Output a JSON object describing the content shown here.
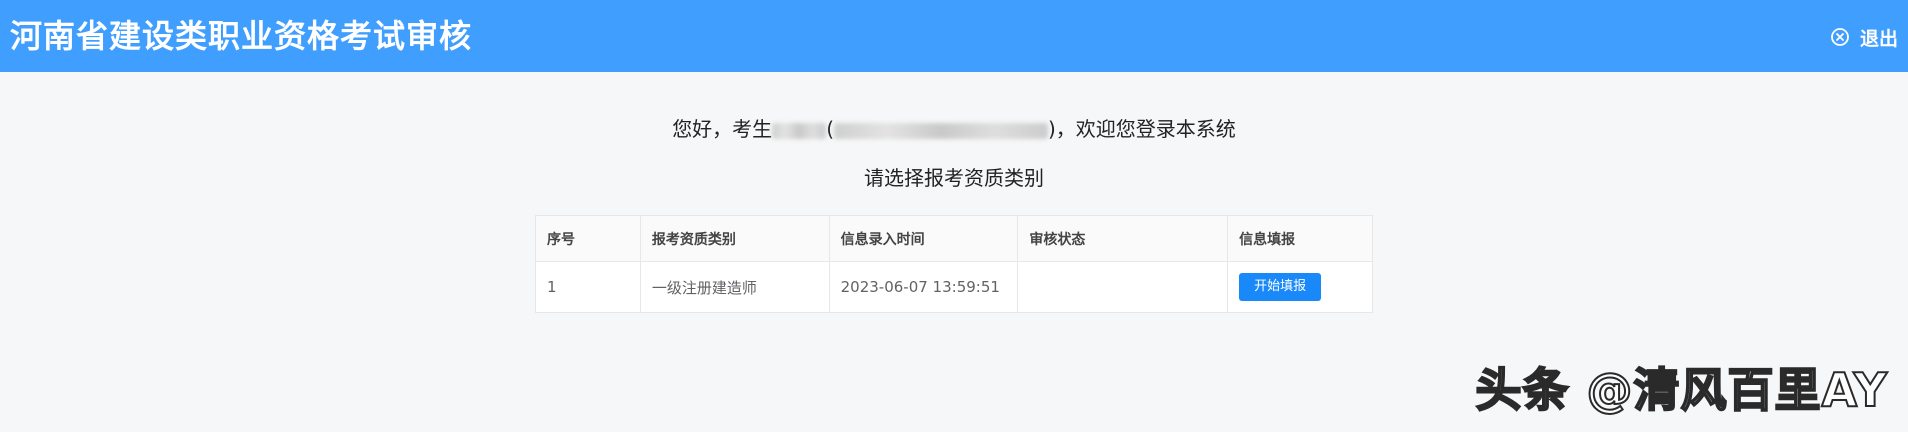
{
  "header": {
    "title": "河南省建设类职业资格考试审核",
    "logout_label": "退出",
    "logout_icon": "close-circle-icon",
    "bg_color": "#409eff"
  },
  "greeting": {
    "prefix": "您好，考生",
    "open_paren": "(",
    "suffix": ")，欢迎您登录本系统"
  },
  "prompt": "请选择报考资质类别",
  "table": {
    "headers": [
      "序号",
      "报考资质类别",
      "信息录入时间",
      "审核状态",
      "信息填报"
    ],
    "rows": [
      {
        "index": "1",
        "category": "一级注册建造师",
        "entry_time": "2023-06-07 13:59:51",
        "status": "",
        "action_label": "开始填报"
      }
    ]
  },
  "watermark": "头条 @清风百里AY",
  "colors": {
    "primary": "#409eff",
    "button": "#1989fa"
  }
}
